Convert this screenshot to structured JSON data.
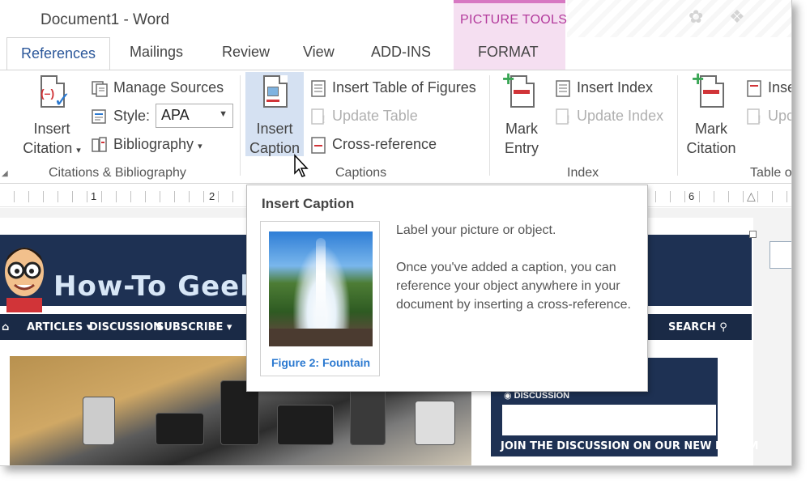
{
  "window": {
    "title": "Document1 - Word",
    "context_band": "PICTURE TOOLS"
  },
  "tabs": [
    {
      "label": "References",
      "active": true
    },
    {
      "label": "Mailings"
    },
    {
      "label": "Review"
    },
    {
      "label": "View"
    },
    {
      "label": "ADD-INS"
    },
    {
      "label": "FORMAT"
    }
  ],
  "ribbon": {
    "citations": {
      "group_label": "Citations & Bibliography",
      "insert_citation_line1": "Insert",
      "insert_citation_line2": "Citation",
      "manage_sources": "Manage Sources",
      "style_label": "Style:",
      "style_value": "APA",
      "bibliography": "Bibliography"
    },
    "captions": {
      "group_label": "Captions",
      "insert_caption_line1": "Insert",
      "insert_caption_line2": "Caption",
      "insert_table_of_figures": "Insert Table of Figures",
      "update_table": "Update Table",
      "cross_reference": "Cross-reference"
    },
    "index": {
      "group_label": "Index",
      "mark_entry_line1": "Mark",
      "mark_entry_line2": "Entry",
      "insert_index": "Insert Index",
      "update_index": "Update Index"
    },
    "table_of_authorities": {
      "group_label": "Table o",
      "mark_citation_line1": "Mark",
      "mark_citation_line2": "Citation",
      "insert_label": "Inse",
      "update_label": "Upc"
    }
  },
  "ruler": {
    "numbers": [
      "1",
      "2",
      "6"
    ]
  },
  "tooltip": {
    "title": "Insert Caption",
    "figure_caption": "Figure 2: Fountain",
    "summary": "Label your picture or object.",
    "detail": "Once you've added a caption, you can reference your object anywhere in your document by inserting a cross-reference."
  },
  "document": {
    "site_title": "How-To Geek",
    "nav": [
      "ARTICLES",
      "DISCUSSION",
      "SUBSCRIBE"
    ],
    "search": "SEARCH",
    "forum_title": "DISCUSSION",
    "forum_banner": "JOIN THE DISCUSSION ON OUR NEW FORUM"
  },
  "colors": {
    "accent": "#2b579a",
    "picture_tools": "#b33a9c",
    "site_navy": "#1e3153"
  }
}
